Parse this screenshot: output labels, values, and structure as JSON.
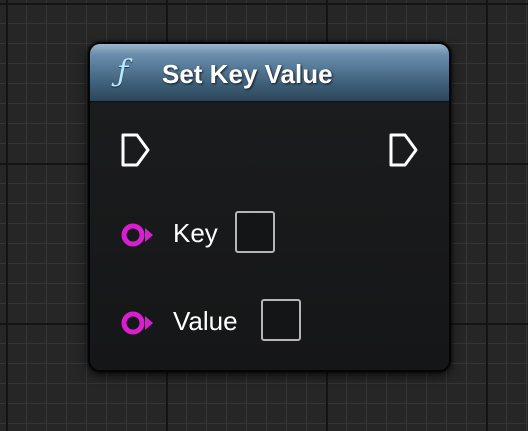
{
  "node": {
    "title": "Set Key Value",
    "icon": "function-icon",
    "icon_glyph": "ƒ",
    "header_color": "#5b7f9d",
    "pins": {
      "exec_in": {
        "type": "exec"
      },
      "exec_out": {
        "type": "exec"
      },
      "key": {
        "label": "Key",
        "type": "data",
        "color": "#d81fd0",
        "value": false
      },
      "value": {
        "label": "Value",
        "type": "data",
        "color": "#d81fd0",
        "value": false
      }
    }
  }
}
